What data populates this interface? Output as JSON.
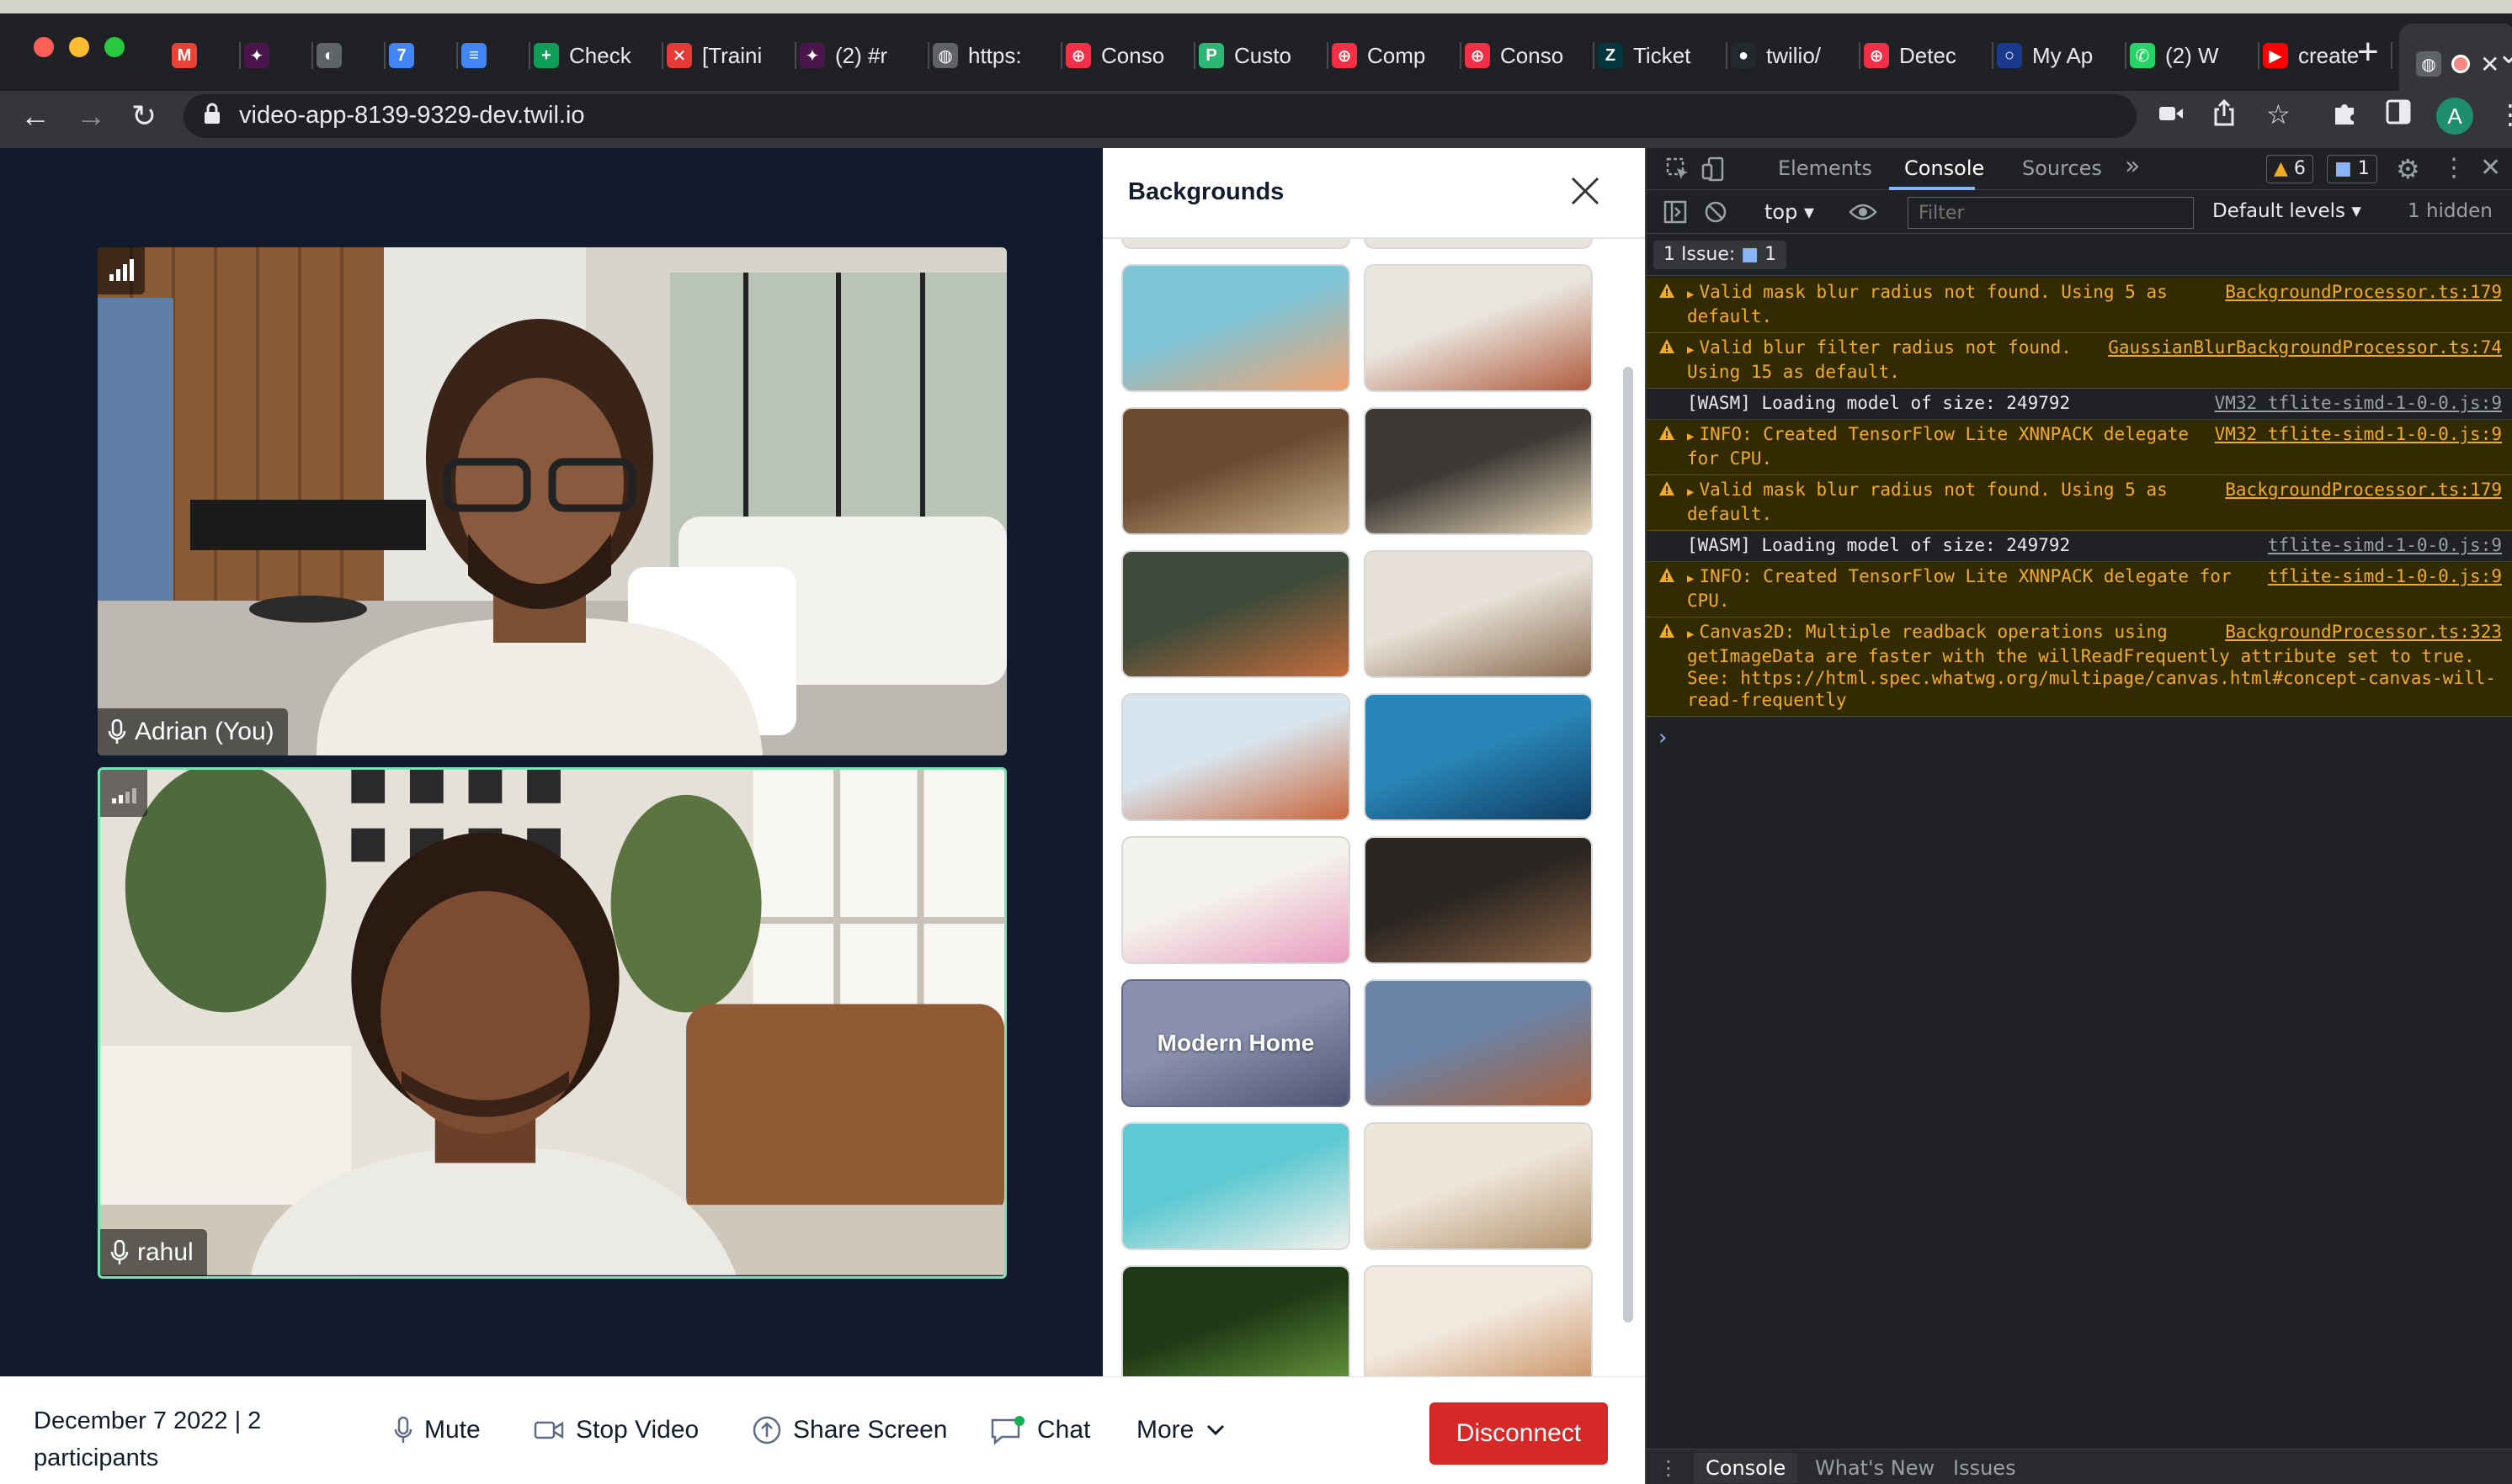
{
  "browser": {
    "tabs": [
      {
        "label": "",
        "icon": "gmail-icon"
      },
      {
        "label": "",
        "icon": "slack-icon"
      },
      {
        "label": "",
        "icon": "github-avatar-icon"
      },
      {
        "label": "",
        "icon": "calendar-icon"
      },
      {
        "label": "",
        "icon": "docs-icon"
      },
      {
        "label": "Check",
        "icon": "sheets-icon"
      },
      {
        "label": "[Traini",
        "icon": "x-mark-icon"
      },
      {
        "label": "(2) #r",
        "icon": "slack-icon"
      },
      {
        "label": "https:",
        "icon": "globe-icon"
      },
      {
        "label": "Conso",
        "icon": "twilio-icon"
      },
      {
        "label": "Custo",
        "icon": "p-icon"
      },
      {
        "label": "Comp",
        "icon": "twilio-icon"
      },
      {
        "label": "Conso",
        "icon": "twilio-icon"
      },
      {
        "label": "Ticket",
        "icon": "zendesk-icon"
      },
      {
        "label": "twilio/",
        "icon": "github-icon"
      },
      {
        "label": "Detec",
        "icon": "twilio-icon"
      },
      {
        "label": "My Ap",
        "icon": "okta-icon"
      },
      {
        "label": "(2) W",
        "icon": "whatsapp-icon"
      },
      {
        "label": "create",
        "icon": "youtube-icon"
      },
      {
        "label": "",
        "icon": "globe-icon"
      }
    ],
    "active_tab_close": "✕",
    "new_tab": "+",
    "url": "video-app-8139-9329-dev.twil.io",
    "profile_initial": "A"
  },
  "room": {
    "participants": [
      {
        "name": "Adrian (You)"
      },
      {
        "name": "rahul"
      }
    ]
  },
  "backgrounds_panel": {
    "title": "Backgrounds",
    "thumbnails": [
      {
        "label": "",
        "colors": [
          "#7fc4d6",
          "#f1a26e"
        ]
      },
      {
        "label": "",
        "colors": [
          "#e9e4dc",
          "#b05a3c"
        ]
      },
      {
        "label": "",
        "colors": [
          "#6b4a30",
          "#c9b08a"
        ]
      },
      {
        "label": "",
        "colors": [
          "#3d3a36",
          "#e9d7b8"
        ]
      },
      {
        "label": "",
        "colors": [
          "#3e4a3a",
          "#c46d3c"
        ]
      },
      {
        "label": "",
        "colors": [
          "#e7e1d7",
          "#8a6a4e"
        ]
      },
      {
        "label": "",
        "colors": [
          "#d9e5ee",
          "#c9663c"
        ]
      },
      {
        "label": "",
        "colors": [
          "#2a86b8",
          "#0f3d63"
        ]
      },
      {
        "label": "",
        "colors": [
          "#f4f2ec",
          "#e99bbf"
        ]
      },
      {
        "label": "",
        "colors": [
          "#2b2622",
          "#8a6243"
        ]
      },
      {
        "label": "Modern Home",
        "colors": [
          "#8a8fab",
          "#4e5574"
        ]
      },
      {
        "label": "",
        "colors": [
          "#6b83a6",
          "#a9603a"
        ]
      },
      {
        "label": "",
        "colors": [
          "#5ec9d2",
          "#f2f0ea"
        ]
      },
      {
        "label": "",
        "colors": [
          "#efe6da",
          "#b3936d"
        ]
      },
      {
        "label": "",
        "colors": [
          "#1f3a16",
          "#6b9a3d"
        ]
      },
      {
        "label": "",
        "colors": [
          "#f2e8de",
          "#c88c5a"
        ]
      }
    ]
  },
  "menu_bar": {
    "meeting_info": "December 7 2022 | 2 participants",
    "mute": "Mute",
    "stop_video": "Stop Video",
    "share_screen": "Share Screen",
    "chat": "Chat",
    "more": "More",
    "disconnect": "Disconnect"
  },
  "devtools": {
    "tabs": [
      "Elements",
      "Console",
      "Sources"
    ],
    "more_tabs": "»",
    "warn_count": "6",
    "info_count": "1",
    "context": "top ▾",
    "filter_placeholder": "Filter",
    "levels": "Default levels ▾",
    "hidden": "1 hidden",
    "issues": "1 Issue:",
    "issues_count": "1",
    "logs": [
      {
        "level": "warn",
        "expand": true,
        "text": "Valid mask blur radius not found. Using 5 as default.",
        "source": "BackgroundProcessor.ts:179"
      },
      {
        "level": "warn",
        "expand": true,
        "text": "Valid blur filter radius not found. Using 15 as default.",
        "source": "GaussianBlurBackgroundProcessor.ts:74"
      },
      {
        "level": "info",
        "expand": false,
        "text": "[WASM] Loading model of size: 249792",
        "source": "VM32 tflite-simd-1-0-0.js:9"
      },
      {
        "level": "warn",
        "expand": true,
        "text": "INFO: Created TensorFlow Lite XNNPACK delegate for CPU.",
        "source": "VM32 tflite-simd-1-0-0.js:9"
      },
      {
        "level": "warn",
        "expand": true,
        "text": "Valid mask blur radius not found. Using 5 as default.",
        "source": "BackgroundProcessor.ts:179"
      },
      {
        "level": "info",
        "expand": false,
        "text": "[WASM] Loading model of size: 249792",
        "source": "tflite-simd-1-0-0.js:9"
      },
      {
        "level": "warn",
        "expand": true,
        "text": "INFO: Created TensorFlow Lite XNNPACK delegate for CPU.",
        "source": "tflite-simd-1-0-0.js:9"
      },
      {
        "level": "warn",
        "expand": true,
        "text": "Canvas2D: Multiple readback operations using getImageData are faster with the willReadFrequently attribute set to true. See: ",
        "link": "https://html.spec.whatwg.org/multipage/canvas.html#concept-canvas-will-read-frequently",
        "source": "BackgroundProcessor.ts:323"
      }
    ],
    "prompt": "›",
    "drawer_tabs": [
      "Console",
      "What's New",
      "Issues"
    ]
  }
}
